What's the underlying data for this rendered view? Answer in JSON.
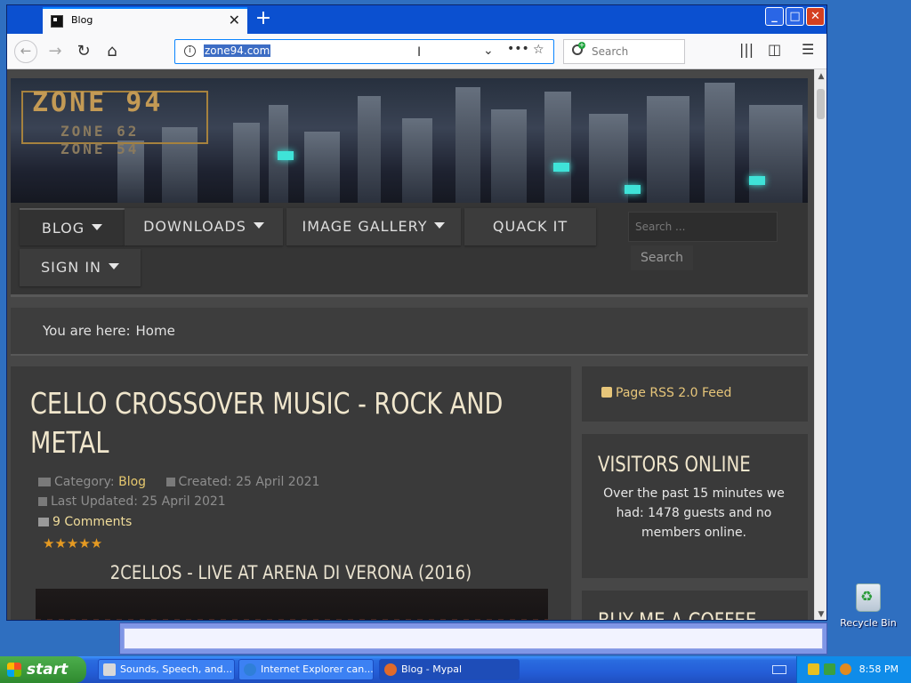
{
  "browser": {
    "tab_title": "Blog",
    "url": "zone94.com",
    "search_placeholder": "Search"
  },
  "site": {
    "logo_main": "ZONE 94",
    "logo_sub1": "ZONE 62",
    "logo_sub2": "ZONE 54",
    "menu": [
      {
        "label": "BLOG"
      },
      {
        "label": "DOWNLOADS"
      },
      {
        "label": "IMAGE GALLERY"
      },
      {
        "label": "QUACK IT"
      },
      {
        "label": "SIGN IN"
      }
    ],
    "search_placeholder": "Search ...",
    "search_button": "Search",
    "breadcrumb_prefix": "You are here:",
    "breadcrumb_current": "Home"
  },
  "article": {
    "title": "CELLO CROSSOVER MUSIC - ROCK AND METAL",
    "category_label": "Category:",
    "category": "Blog",
    "created": "Created: 25 April 2021",
    "updated": "Last Updated: 25 April 2021",
    "comments": "9 Comments",
    "stars": "★★★★★",
    "video_title": "2CELLOS - LIVE AT ARENA DI VERONA (2016)"
  },
  "sidebar": {
    "rss": "Page RSS 2.0 Feed",
    "visitors_title": "VISITORS ONLINE",
    "visitors_text": "Over the past 15 minutes we had: 1478 guests and no members online.",
    "coffee_title": "BUY ME A COFFEE"
  },
  "desktop": {
    "recycle_bin": "Recycle Bin"
  },
  "taskbar": {
    "start": "start",
    "tasks": [
      {
        "label": "Sounds, Speech, and..."
      },
      {
        "label": "Internet Explorer can..."
      },
      {
        "label": "Blog - Mypal"
      }
    ],
    "clock": "8:58 PM"
  }
}
